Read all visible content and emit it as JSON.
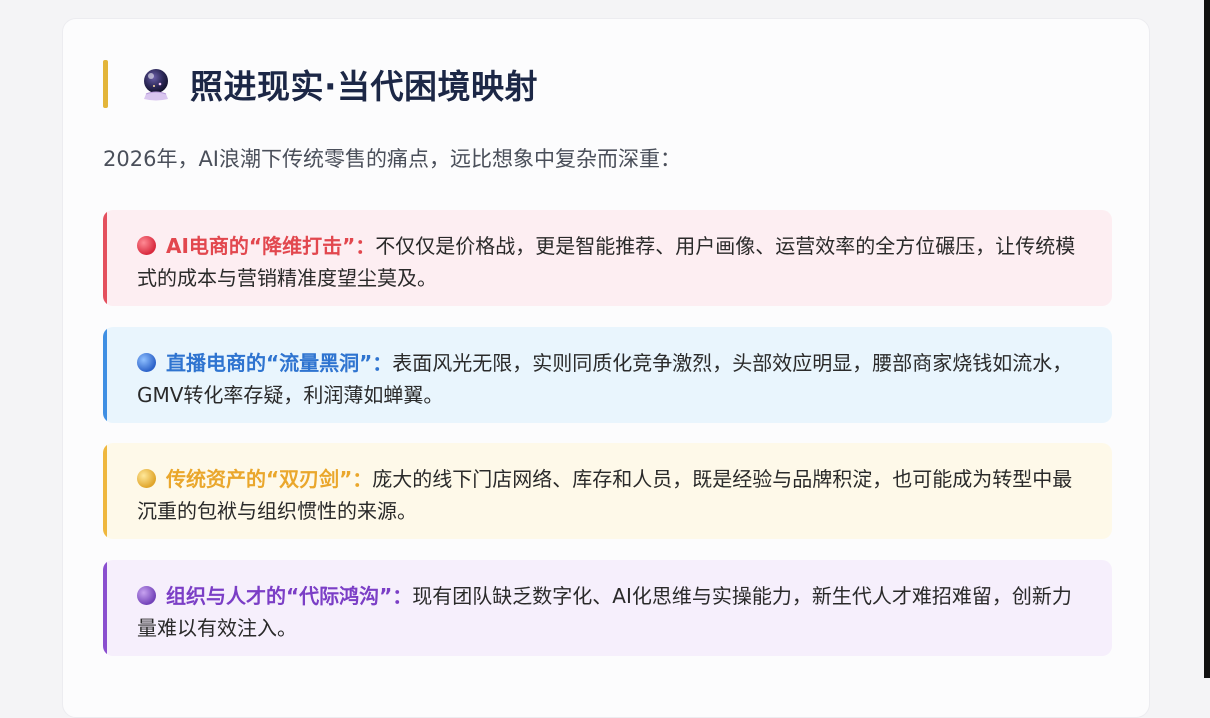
{
  "section": {
    "title": "照进现实·当代困境映射",
    "title_icon": "crystal-ball-icon",
    "intro": "2026年，AI浪潮下传统零售的痛点，远比想象中复杂而深重："
  },
  "items": [
    {
      "color": "#e2474e",
      "icon": "red-circle-icon",
      "heading": "AI电商的“降维打击”：",
      "body": "不仅仅是价格战，更是智能推荐、用户画像、运营效率的全方位碾压，让传统模式的成本与营销精准度望尘莫及。"
    },
    {
      "color": "#2f74d0",
      "icon": "blue-circle-icon",
      "heading": "直播电商的“流量黑洞”：",
      "body": "表面风光无限，实则同质化竞争激烈，头部效应明显，腰部商家烧钱如流水，GMV转化率存疑，利润薄如蝉翼。"
    },
    {
      "color": "#eaa72c",
      "icon": "yellow-circle-icon",
      "heading": "传统资产的“双刃剑”：",
      "body": "庞大的线下门店网络、库存和人员，既是经验与品牌积淀，也可能成为转型中最沉重的包袱与组织惯性的来源。"
    },
    {
      "color": "#7b3ec6",
      "icon": "purple-circle-icon",
      "heading": "组织与人才的“代际鸿沟”：",
      "body": "现有团队缺乏数字化、AI化思维与实操能力，新生代人才难招难留，创新力量难以有效注入。"
    }
  ]
}
